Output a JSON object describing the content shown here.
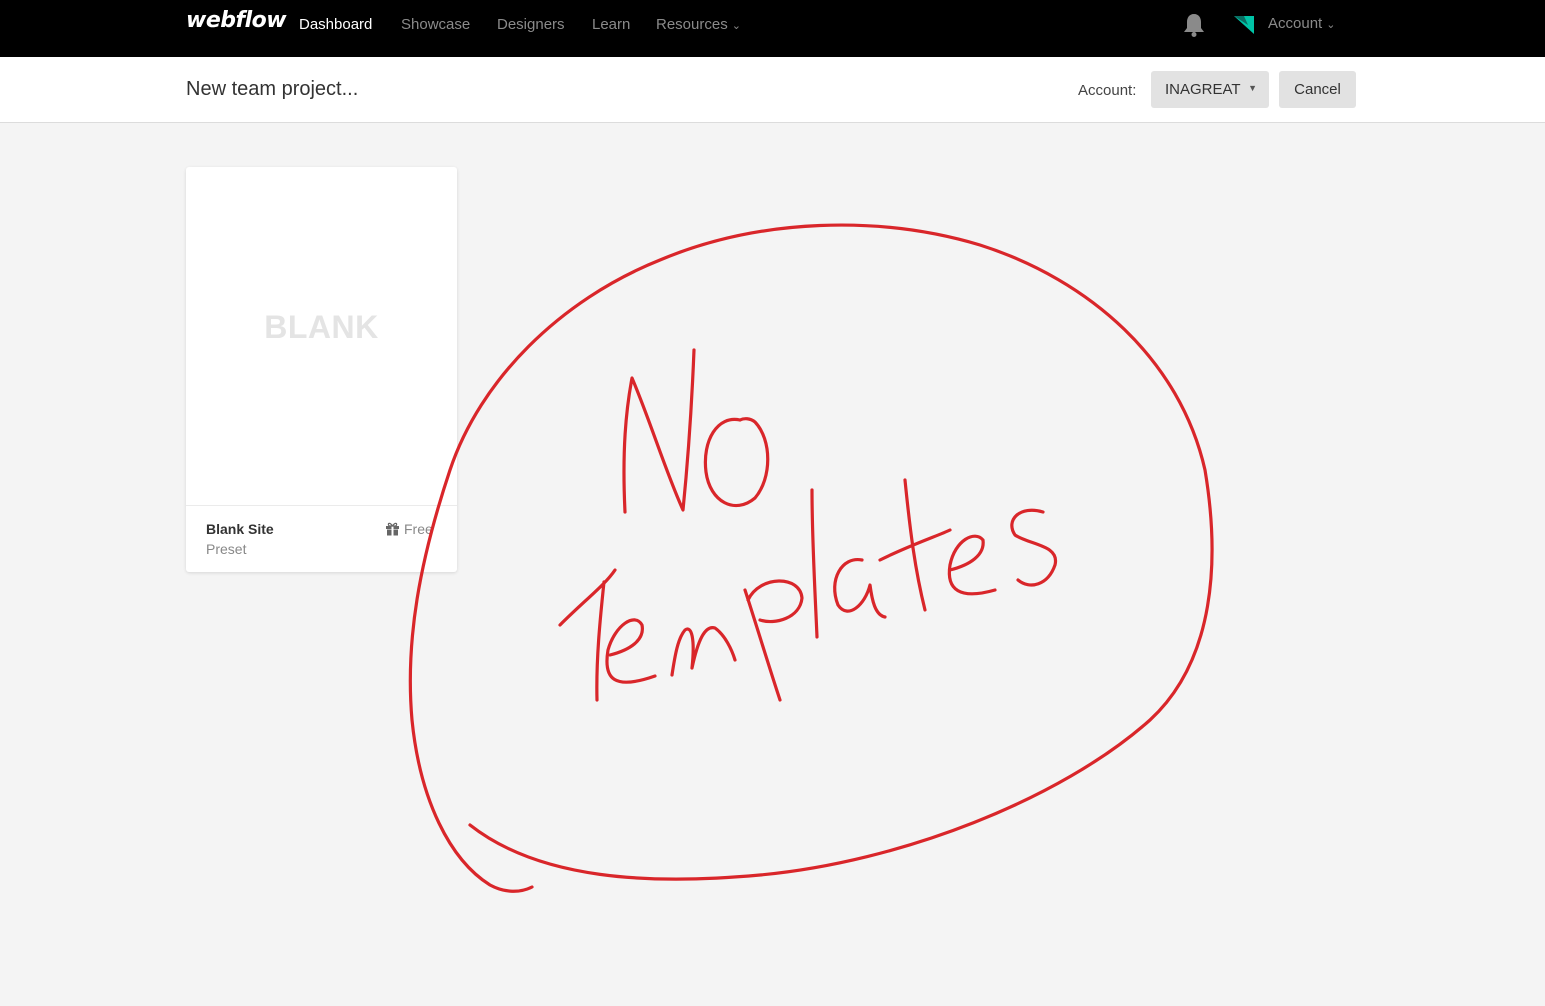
{
  "nav": {
    "logo": "webflow",
    "links": [
      "Dashboard",
      "Showcase",
      "Designers",
      "Learn",
      "Resources"
    ],
    "active": "Dashboard",
    "bell_icon": "bell-icon",
    "account_label": "Account"
  },
  "subheader": {
    "title": "New team project...",
    "account_label": "Account:",
    "account_value": "INAGREAT",
    "cancel_label": "Cancel"
  },
  "card": {
    "preview_text": "BLANK",
    "name": "Blank Site",
    "subtitle": "Preset",
    "price": "Free",
    "price_icon": "gift-icon"
  },
  "annotation": {
    "text": "No Templates",
    "color": "#d9262a"
  },
  "colors": {
    "nav_bg": "#000000",
    "page_bg": "#f4f4f4",
    "accent": "#00c4a7"
  }
}
